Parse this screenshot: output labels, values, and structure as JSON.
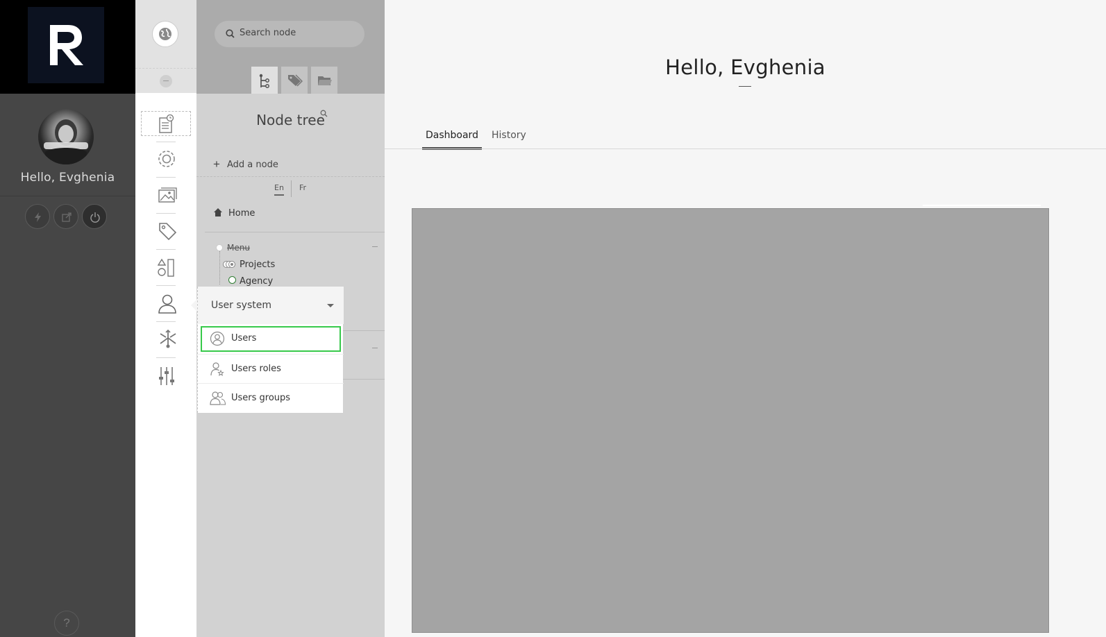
{
  "logo": {
    "letter": "R"
  },
  "user": {
    "greeting": "Hello, Evghenia"
  },
  "user_actions": [
    {
      "name": "quick-action",
      "icon": "lightning-icon"
    },
    {
      "name": "external-link",
      "icon": "external-link-icon"
    },
    {
      "name": "logout",
      "icon": "power-icon"
    }
  ],
  "help": {
    "label": "?"
  },
  "nav": {
    "items": [
      {
        "id": "content",
        "icon": "document-clock-icon",
        "active": true
      },
      {
        "id": "settings",
        "icon": "gear-icon"
      },
      {
        "id": "documents",
        "icon": "images-icon"
      },
      {
        "id": "tags",
        "icon": "tag-icon"
      },
      {
        "id": "shapes",
        "icon": "shapes-icon"
      },
      {
        "id": "users",
        "icon": "user-icon"
      },
      {
        "id": "network",
        "icon": "network-icon"
      },
      {
        "id": "tools",
        "icon": "sliders-icon"
      }
    ]
  },
  "tree": {
    "search_placeholder": "Search node",
    "tabs": [
      {
        "id": "tree",
        "icon": "tree-icon",
        "active": true
      },
      {
        "id": "tags",
        "icon": "tags-icon"
      },
      {
        "id": "folders",
        "icon": "folder-icon"
      }
    ],
    "title": "Node tree",
    "add_node": "Add a node",
    "add_node_icon": "+",
    "languages": [
      "En",
      "Fr"
    ],
    "home": "Home",
    "nodes": {
      "menu": "Menu",
      "projects": "Projects",
      "agency": "Agency"
    }
  },
  "submenu": {
    "title": "User system",
    "items": [
      {
        "label": "Users",
        "icon": "user-circle-icon",
        "highlighted": true
      },
      {
        "label": "Users roles",
        "icon": "user-role-icon"
      },
      {
        "label": "Users groups",
        "icon": "users-group-icon"
      }
    ]
  },
  "main": {
    "title": "Hello, Evghenia",
    "tabs": [
      "Dashboard",
      "History"
    ],
    "active_tab": "Dashboard"
  },
  "colors": {
    "highlight": "#37c94a",
    "user_column": "#464646",
    "logo_bg": "#0c1220"
  }
}
